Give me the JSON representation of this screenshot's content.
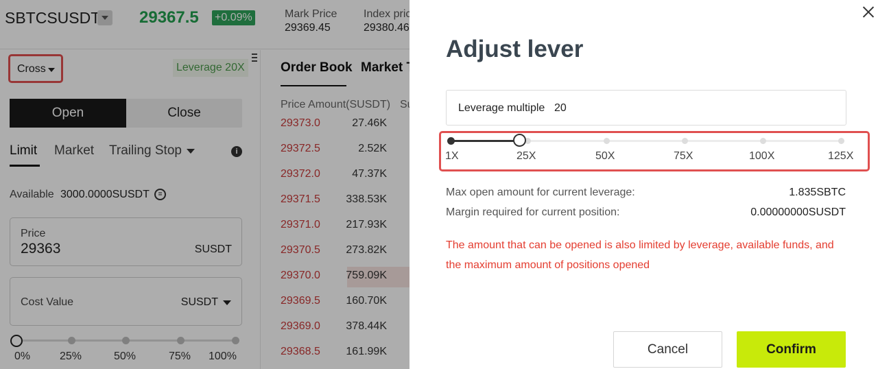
{
  "header": {
    "symbol": "SBTCSUSDT",
    "last_price": "29367.5",
    "change": "+0.09%",
    "mark_price_label": "Mark Price",
    "mark_price_value": "29369.45",
    "index_price_label": "Index pric",
    "index_price_value": "29380.46"
  },
  "trade_panel": {
    "margin_mode": "Cross",
    "leverage_tag": "Leverage 20X",
    "open_label": "Open",
    "close_label": "Close",
    "order_types": [
      "Limit",
      "Market",
      "Trailing Stop"
    ],
    "available_label": "Available",
    "available_value": "3000.0000SUSDT",
    "price_label": "Price",
    "price_value": "29363",
    "price_unit": "SUSDT",
    "cost_label": "Cost Value",
    "cost_unit": "SUSDT",
    "percent_marks": [
      "0%",
      "25%",
      "50%",
      "75%",
      "100%"
    ],
    "percent_value": 0
  },
  "orderbook": {
    "tabs": [
      "Order Book",
      "Market T"
    ],
    "header": "Price Amount(SUSDT)",
    "header2": "Su",
    "rows": [
      {
        "price": "29373.0",
        "amount": "27.46K",
        "depth": 0
      },
      {
        "price": "29372.5",
        "amount": "2.52K",
        "depth": 0
      },
      {
        "price": "29372.0",
        "amount": "47.37K",
        "depth": 0
      },
      {
        "price": "29371.5",
        "amount": "338.53K",
        "depth": 0.07
      },
      {
        "price": "29371.0",
        "amount": "217.93K",
        "depth": 0
      },
      {
        "price": "29370.5",
        "amount": "273.82K",
        "depth": 0
      },
      {
        "price": "29370.0",
        "amount": "759.09K",
        "depth": 0.51
      },
      {
        "price": "29369.5",
        "amount": "160.70K",
        "depth": 0
      },
      {
        "price": "29369.0",
        "amount": "378.44K",
        "depth": 0.12
      },
      {
        "price": "29368.5",
        "amount": "161.99K",
        "depth": 0
      }
    ]
  },
  "modal": {
    "title": "Adjust lever",
    "leverage_label": "Leverage multiple",
    "leverage_value": "20",
    "slider_marks": [
      "1X",
      "25X",
      "50X",
      "75X",
      "100X",
      "125X"
    ],
    "slider_min": 1,
    "slider_max": 125,
    "slider_value": 20,
    "max_open_label": "Max open amount for current leverage:",
    "max_open_value": "1.835SBTC",
    "margin_label": "Margin required for current position:",
    "margin_value": "0.00000000SUSDT",
    "warning_line1": "The amount that can be opened is also limited by leverage, available funds, and",
    "warning_line2": "the maximum amount of positions opened",
    "cancel_label": "Cancel",
    "confirm_label": "Confirm"
  },
  "colors": {
    "accent_green": "#23a04f",
    "confirm": "#c8ea0a",
    "warning": "#e43d30",
    "ask_red": "#c93a3a",
    "highlight_border": "#e05050"
  }
}
